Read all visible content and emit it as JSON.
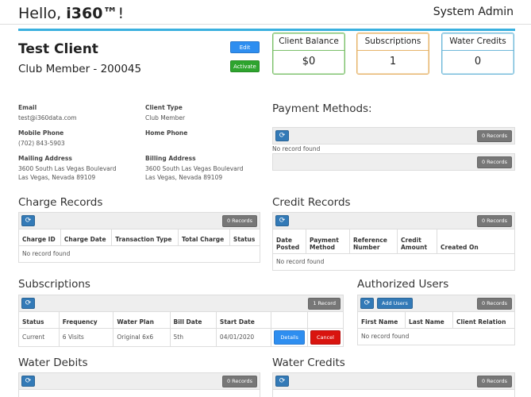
{
  "header": {
    "hello_prefix": "Hello, ",
    "hello_user": "i360™",
    "hello_suffix": "!",
    "system_admin": "System Admin",
    "accent_color": "#3ab0df"
  },
  "client": {
    "name": "Test Client",
    "membership": "Club Member - 200045",
    "edit_label": "Edit",
    "activate_label": "Activate"
  },
  "stats": {
    "balance_label": "Client Balance",
    "balance_value": "$0",
    "subscriptions_label": "Subscriptions",
    "subscriptions_value": "1",
    "water_credits_label": "Water Credits",
    "water_credits_value": "0"
  },
  "info": {
    "email_label": "Email",
    "email_value": "test@i360data.com",
    "client_type_label": "Client Type",
    "client_type_value": "Club Member",
    "mobile_label": "Mobile Phone",
    "mobile_value": "(702) 843-5903",
    "home_label": "Home Phone",
    "mailing_label": "Mailing Address",
    "mailing_line1": "3600 South Las Vegas Boulevard",
    "mailing_line2": "Las Vegas, Nevada 89109",
    "billing_label": "Billing Address",
    "billing_line1": "3600 South Las Vegas Boulevard",
    "billing_line2": "Las Vegas, Nevada 89109"
  },
  "payment_methods": {
    "title": "Payment Methods:",
    "records_top": "0 Records",
    "no_record": "No record found",
    "records_bottom": "0 Records"
  },
  "charge_records": {
    "title": "Charge Records",
    "records": "0 Records",
    "columns": [
      "Charge ID",
      "Charge Date",
      "Transaction Type",
      "Total Charge",
      "Status"
    ],
    "no_record": "No record found"
  },
  "credit_records": {
    "title": "Credit Records",
    "records": "0 Records",
    "columns": [
      "Date Posted",
      "Payment Method",
      "Reference Number",
      "Credit Amount",
      "Created On"
    ],
    "no_record": "No record found"
  },
  "subscriptions": {
    "title": "Subscriptions",
    "records": "1 Record",
    "columns": [
      "Status",
      "Frequency",
      "Water Plan",
      "Bill Date",
      "Start Date"
    ],
    "rows": [
      {
        "status": "Current",
        "frequency": "6 Visits",
        "plan": "Original 6x6",
        "bill_date": "5th",
        "start_date": "04/01/2020",
        "details": "Details",
        "cancel": "Cancel"
      }
    ]
  },
  "authorized_users": {
    "title": "Authorized Users",
    "add_label": "Add Users",
    "records": "0 Records",
    "columns": [
      "First Name",
      "Last Name",
      "Client Relation"
    ],
    "no_record": "No record found"
  },
  "water_debits": {
    "title": "Water Debits",
    "records": "0 Records"
  },
  "water_credits": {
    "title": "Water Credits",
    "records": "0 Records"
  }
}
